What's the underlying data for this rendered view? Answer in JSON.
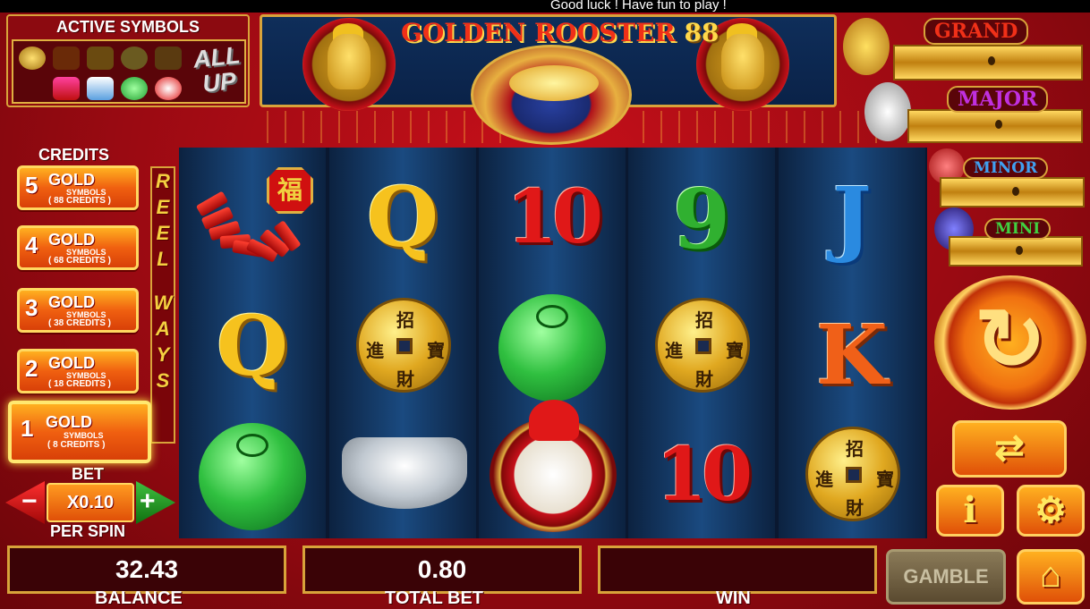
{
  "ticker": {
    "message": "Good luck ! Have fun to play !"
  },
  "title": {
    "name": "GOLDEN ROOSTER",
    "number": "88"
  },
  "active_symbols": {
    "title": "ACTIVE SYMBOLS",
    "all_up_line1": "ALL",
    "all_up_line2": "UP"
  },
  "credits": {
    "title": "CREDITS",
    "options": [
      {
        "count": "5",
        "gold": "GOLD",
        "symbols": "SYMBOLS",
        "credits": "( 88 CREDITS )",
        "selected": false
      },
      {
        "count": "4",
        "gold": "GOLD",
        "symbols": "SYMBOLS",
        "credits": "( 68 CREDITS )",
        "selected": false
      },
      {
        "count": "3",
        "gold": "GOLD",
        "symbols": "SYMBOLS",
        "credits": "( 38 CREDITS )",
        "selected": false
      },
      {
        "count": "2",
        "gold": "GOLD",
        "symbols": "SYMBOLS",
        "credits": "( 18 CREDITS )",
        "selected": false
      },
      {
        "count": "1",
        "gold": "GOLD",
        "symbols": "SYMBOLS",
        "credits": "( 8 CREDITS )",
        "selected": true
      }
    ]
  },
  "reel_ways": {
    "letters": [
      "R",
      "E",
      "E",
      "L",
      "W",
      "A",
      "Y",
      "S"
    ]
  },
  "bet": {
    "label": "BET",
    "value": "X0.10",
    "per_spin": "PER SPIN",
    "minus": "−",
    "plus": "+"
  },
  "reels": {
    "grid": [
      [
        "firecrackers",
        "Q",
        "jade-dragon"
      ],
      [
        "Q",
        "gold-coin",
        "silver-ingot"
      ],
      [
        "10",
        "jade-dragon",
        "rooster"
      ],
      [
        "9",
        "gold-coin",
        "10"
      ],
      [
        "J",
        "K",
        "gold-coin"
      ]
    ],
    "coin_chars": [
      "招",
      "進",
      "寶",
      "財"
    ],
    "fu_char": "福"
  },
  "jackpots": [
    {
      "label": "GRAND",
      "color": "#f03018"
    },
    {
      "label": "MAJOR",
      "color": "#c030e0"
    },
    {
      "label": "MINOR",
      "color": "#40a0f0"
    },
    {
      "label": "MINI",
      "color": "#40d040"
    }
  ],
  "controls": {
    "spin_icon": "refresh-icon",
    "autoplay_icon": "repeat-icon",
    "info_label": "i",
    "settings_icon": "gear-icon",
    "gamble_label": "GAMBLE",
    "home_icon": "home-icon"
  },
  "meters": {
    "balance_value": "32.43",
    "balance_label": "BALANCE",
    "total_bet_value": "0.80",
    "total_bet_label": "TOTAL BET",
    "win_value": "",
    "win_label": "WIN"
  }
}
